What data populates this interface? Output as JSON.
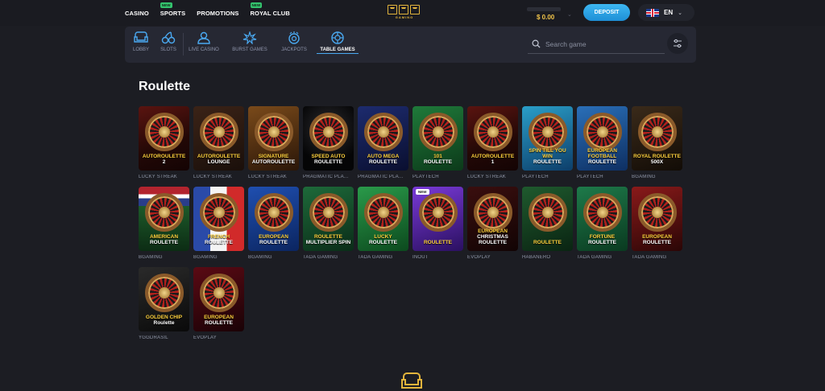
{
  "topnav": [
    {
      "label": "CASINO",
      "badge": ""
    },
    {
      "label": "SPORTS",
      "badge": "NEW"
    },
    {
      "label": "PROMOTIONS",
      "badge": ""
    },
    {
      "label": "ROYAL CLUB",
      "badge": "NEW"
    }
  ],
  "logo": {
    "sub": "GAMING"
  },
  "balance": {
    "amount": "$ 0.00"
  },
  "deposit_label": "DEPOSIT",
  "language": {
    "code": "EN"
  },
  "categories": [
    {
      "label": "LOBBY",
      "icon": "sofa-icon"
    },
    {
      "label": "SLOTS",
      "icon": "cherry-icon"
    },
    {
      "label": "LIVE CASINO",
      "icon": "dealer-icon"
    },
    {
      "label": "BURST GAMES",
      "icon": "burst-icon"
    },
    {
      "label": "JACKPOTS",
      "icon": "jackpot-icon"
    },
    {
      "label": "TABLE GAMES",
      "icon": "roulette-icon"
    }
  ],
  "search": {
    "placeholder": "Search game"
  },
  "section_title": "Roulette",
  "colors": {
    "accent": "#4aa9f1",
    "gold": "#f2c54a",
    "background": "#1c1d23"
  },
  "games": [
    {
      "title": "AUTOROULETTE",
      "title2": "2",
      "provider": "LUCKY STREAK",
      "new": ""
    },
    {
      "title": "AUTOROULETTE",
      "title2": "LOUNGE",
      "provider": "LUCKY STREAK",
      "new": ""
    },
    {
      "title": "SIGNATURE",
      "title2": "AUTOROULETTE",
      "provider": "LUCKY STREAK",
      "new": ""
    },
    {
      "title": "SPEED AUTO",
      "title2": "ROULETTE",
      "provider": "PRAGMATIC PLA...",
      "new": ""
    },
    {
      "title": "AUTO MEGA",
      "title2": "ROULETTE",
      "provider": "PRAGMATIC PLA...",
      "new": ""
    },
    {
      "title": "101",
      "title2": "ROULETTE",
      "provider": "PLAYTECH",
      "new": ""
    },
    {
      "title": "AUTOROULETTE",
      "title2": "1",
      "provider": "LUCKY STREAK",
      "new": ""
    },
    {
      "title": "SPIN TILL YOU WIN",
      "title2": "ROULETTE",
      "provider": "PLAYTECH",
      "new": ""
    },
    {
      "title": "EUROPEAN FOOTBALL",
      "title2": "ROULETTE",
      "provider": "PLAYTECH",
      "new": ""
    },
    {
      "title": "ROYAL ROULETTE",
      "title2": "500X",
      "provider": "BGAMING",
      "new": ""
    },
    {
      "title": "AMERICAN",
      "title2": "ROULETTE",
      "provider": "BGAMING",
      "new": ""
    },
    {
      "title": "FRENCH",
      "title2": "ROULETTE",
      "provider": "BGAMING",
      "new": ""
    },
    {
      "title": "EUROPEAN",
      "title2": "ROULETTE",
      "provider": "BGAMING",
      "new": ""
    },
    {
      "title": "ROULETTE",
      "title2": "MULTIPLIER SPIN",
      "provider": "TADA GAMING",
      "new": ""
    },
    {
      "title": "LUCKY",
      "title2": "ROULETTE",
      "provider": "TADA GAMING",
      "new": ""
    },
    {
      "title": "ROULETTE",
      "title2": "",
      "provider": "INOUT",
      "new": "NEW"
    },
    {
      "title": "EUROPEAN",
      "title2": "CHRISTMAS ROULETTE",
      "provider": "EVOPLAY",
      "new": ""
    },
    {
      "title": "ROULETTE",
      "title2": "",
      "provider": "HABANERO",
      "new": ""
    },
    {
      "title": "FORTUNE",
      "title2": "ROULETTE",
      "provider": "TADA GAMING",
      "new": ""
    },
    {
      "title": "EUROPEAN",
      "title2": "ROULETTE",
      "provider": "TADA GAMING",
      "new": ""
    },
    {
      "title": "GOLDEN CHIP",
      "title2": "Roulette",
      "provider": "YGGDRASIL",
      "new": ""
    },
    {
      "title": "EUROPEAN",
      "title2": "ROULETTE",
      "provider": "EVOPLAY",
      "new": ""
    }
  ]
}
